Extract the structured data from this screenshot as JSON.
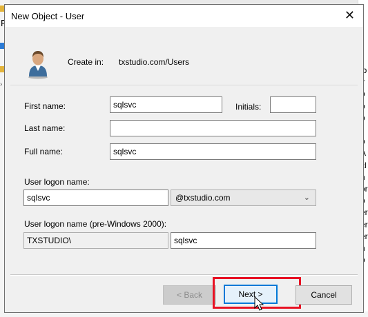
{
  "background": {
    "left_char": "F",
    "right_chars": [
      "ip",
      "ir",
      "b",
      "b",
      "b",
      "r",
      "b",
      "A",
      "cl",
      "n",
      "or",
      "b",
      "er",
      "er",
      "er",
      "n",
      "b"
    ]
  },
  "dialog": {
    "title": "New Object - User",
    "create_in_label": "Create in:",
    "create_in_path": "txstudio.com/Users",
    "first_name_label": "First name:",
    "first_name_value": "sqlsvc",
    "initials_label": "Initials:",
    "initials_value": "",
    "last_name_label": "Last name:",
    "last_name_value": "",
    "full_name_label": "Full name:",
    "full_name_value": "sqlsvc",
    "logon_label": "User logon name:",
    "logon_value": "sqlsvc",
    "domain_value": "@txstudio.com",
    "pre2000_label": "User logon name (pre-Windows 2000):",
    "pre2000_domain": "TXSTUDIO\\",
    "pre2000_value": "sqlsvc",
    "buttons": {
      "back": "< Back",
      "next": "Next >",
      "cancel": "Cancel"
    }
  },
  "colors": {
    "highlight": "#e81123",
    "focus": "#0078d7"
  },
  "icons": {
    "close": "close-icon",
    "user": "user-icon",
    "dropdown": "chevron-down-icon",
    "cursor": "mouse-pointer-icon"
  }
}
